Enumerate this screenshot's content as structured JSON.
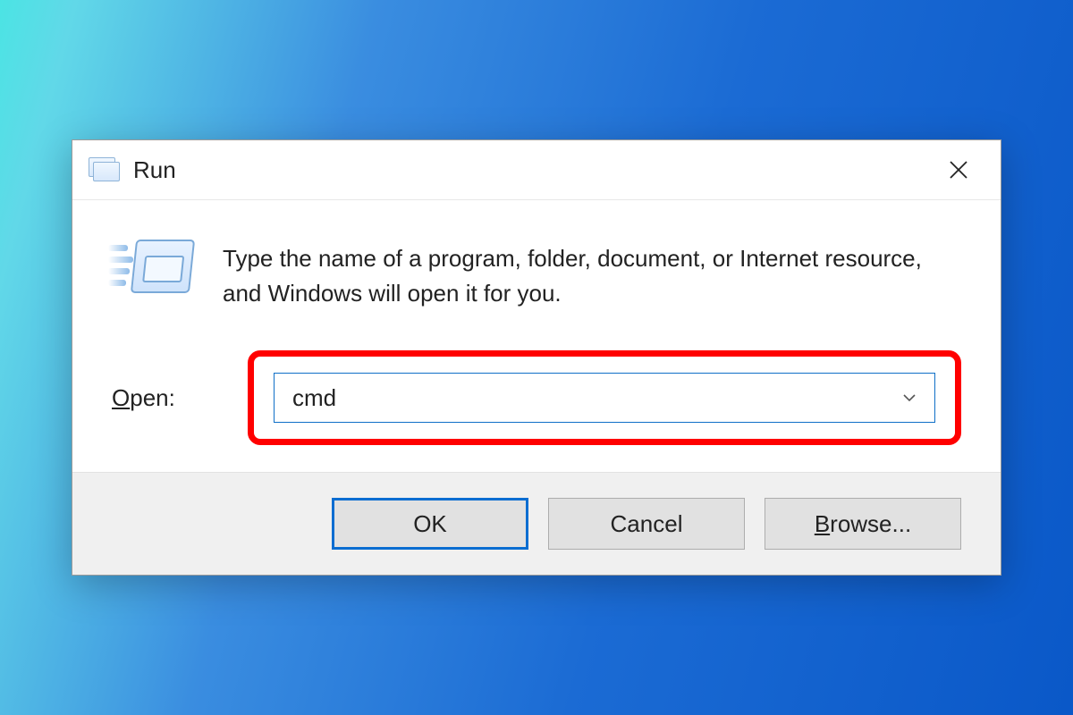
{
  "titlebar": {
    "title": "Run"
  },
  "description": "Type the name of a program, folder, document, or Internet resource, and Windows will open it for you.",
  "open": {
    "label_prefix": "O",
    "label_rest": "pen:",
    "value": "cmd"
  },
  "buttons": {
    "ok": "OK",
    "cancel": "Cancel",
    "browse_prefix": "B",
    "browse_rest": "rowse..."
  }
}
